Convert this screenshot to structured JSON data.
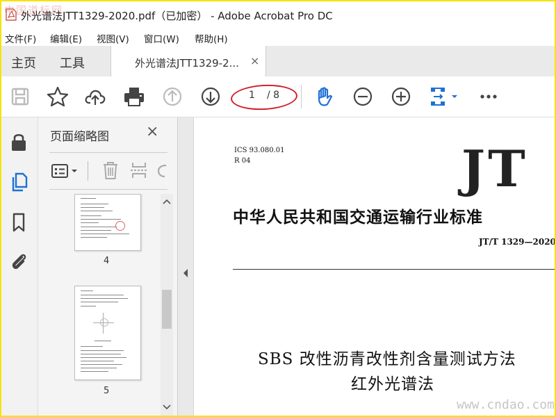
{
  "window": {
    "title": "外光谱法JTT1329-2020.pdf（已加密） - Adobe Acrobat Pro DC"
  },
  "watermarks": {
    "top": "中国道标网",
    "bottom": "www.cndao.com"
  },
  "menu": [
    "文件(F)",
    "编辑(E)",
    "视图(V)",
    "窗口(W)",
    "帮助(H)"
  ],
  "tabs": {
    "home": "主页",
    "tools": "工具",
    "document": "外光谱法JTT1329-2...",
    "close": "×"
  },
  "toolbar": {
    "icons": [
      "save-icon",
      "star-icon",
      "upload-icon",
      "print-icon",
      "page-up-icon",
      "page-down-icon",
      "hand-icon",
      "zoom-out-icon",
      "zoom-in-icon",
      "fit-page-icon",
      "more-icon"
    ],
    "current_page": "1",
    "total_pages": "/ 8",
    "accent": "#1e70d6",
    "annotation_color": "#d0202a"
  },
  "sidebar": {
    "icons": [
      "lock-icon",
      "pages-icon",
      "bookmark-icon",
      "attachment-icon"
    ]
  },
  "panel": {
    "title": "页面缩略图",
    "close": "×",
    "pages": [
      {
        "number": "4"
      },
      {
        "number": "5"
      }
    ]
  },
  "document": {
    "ics": "ICS 93.080.01",
    "r": "R 04",
    "logo": "JT",
    "standard_title": "中华人民共和国交通运输行业标准",
    "code": "JT/T 1329—2020",
    "title_line1": "SBS 改性沥青改性剂含量测试方法",
    "title_line2": "红外光谱法"
  }
}
